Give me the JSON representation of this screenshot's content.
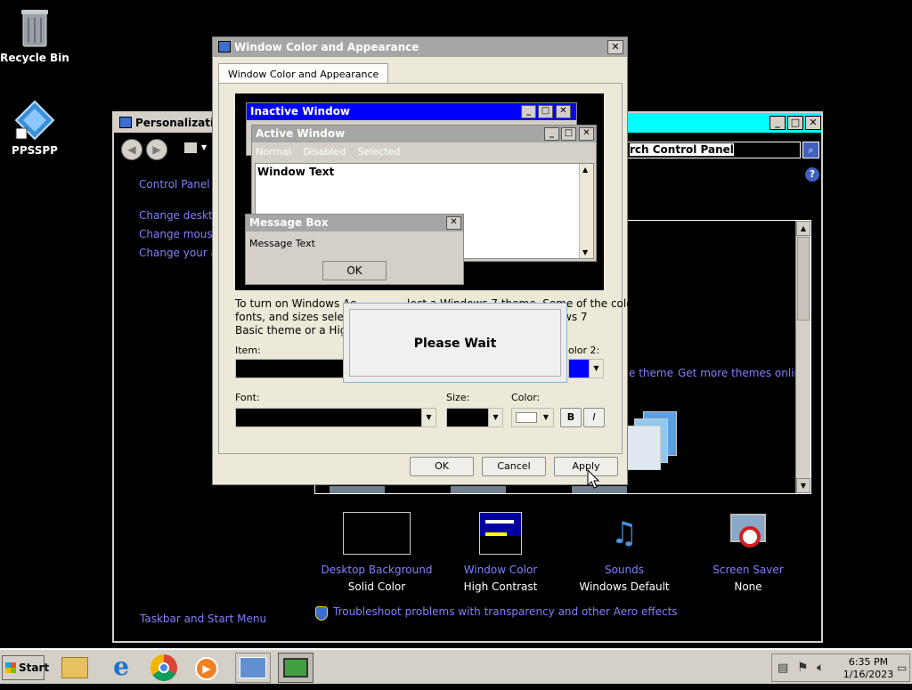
{
  "desktop": {
    "icons": [
      {
        "label": "Recycle Bin"
      },
      {
        "label": "PPSSPP"
      }
    ]
  },
  "personalization": {
    "title": "Personalization",
    "search_text": "rch Control Panel",
    "sidebar": {
      "home": "Control Panel Hor",
      "links": [
        "Change desktop",
        "Change mouse p",
        "Change your acc"
      ],
      "see_also": "Taskbar and Start Menu"
    },
    "theme_links": [
      "e theme",
      "Get more themes online"
    ],
    "bottom": [
      {
        "label": "Desktop Background",
        "sub": "Solid Color"
      },
      {
        "label": "Window Color",
        "sub": "High Contrast"
      },
      {
        "label": "Sounds",
        "sub": "Windows Default"
      },
      {
        "label": "Screen Saver",
        "sub": "None"
      }
    ],
    "troubleshoot": "Troubleshoot problems with transparency and other Aero effects"
  },
  "dialog": {
    "title": "Window Color and Appearance",
    "tab": "Window Color and Appearance",
    "preview": {
      "inactive": "Inactive Window",
      "active": "Active Window",
      "menu": [
        "Normal",
        "Disabled",
        "Selected"
      ],
      "window_text": "Window Text",
      "msgbox_title": "Message Box",
      "msgbox_text": "Message Text",
      "msgbox_ok": "OK"
    },
    "desc_lines": [
      "To turn on Windows Ae",
      "lect a Windows 7 theme. Some of the colors,",
      "fonts, and sizes selected",
      "ws 7",
      "Basic theme or a High C"
    ],
    "item_label": "Item:",
    "color2_label": "olor 2:",
    "font_label": "Font:",
    "size_label": "Size:",
    "color_label": "Color:",
    "bold": "B",
    "italic": "I",
    "ok": "OK",
    "cancel": "Cancel",
    "apply": "Apply"
  },
  "wait": {
    "text": "Please Wait"
  },
  "taskbar": {
    "start": "Start",
    "time": "6:35 PM",
    "date": "1/16/2023"
  }
}
